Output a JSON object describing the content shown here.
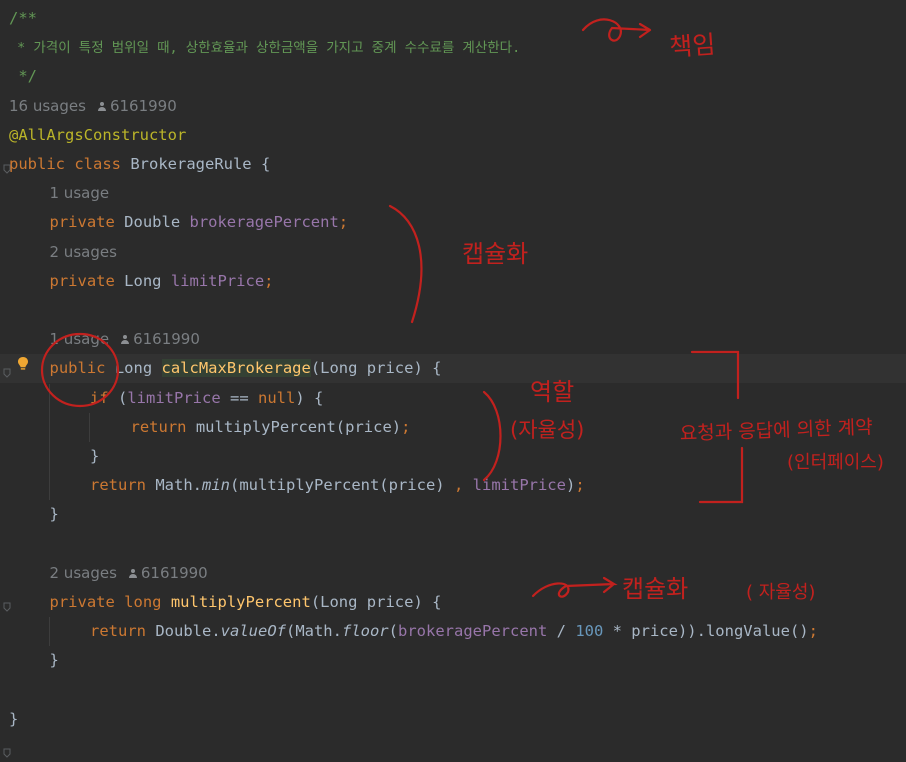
{
  "editor": {
    "lines": [
      {
        "indent": 0,
        "type": "comment",
        "text": "/**"
      },
      {
        "indent": 0,
        "type": "comment",
        "text": " * 가격이 특정 범위일 때, 상한효율과 상한금액을 가지고 중계 수수료를 계산한다."
      },
      {
        "indent": 0,
        "type": "comment",
        "text": " */"
      },
      {
        "indent": 0,
        "type": "hint",
        "usage": "16 usages",
        "author": "6161990"
      },
      {
        "indent": 0,
        "type": "code",
        "tokens": [
          {
            "t": "@AllArgsConstructor",
            "c": "anno"
          }
        ]
      },
      {
        "indent": 0,
        "type": "code",
        "tokens": [
          {
            "t": "public class ",
            "c": "kw"
          },
          {
            "t": "BrokerageRule {"
          }
        ]
      },
      {
        "indent": 1,
        "type": "hint",
        "usage": "1 usage"
      },
      {
        "indent": 1,
        "type": "code",
        "tokens": [
          {
            "t": "private ",
            "c": "kw"
          },
          {
            "t": "Double "
          },
          {
            "t": "brokeragePercent",
            "c": "field"
          },
          {
            "t": ";",
            "c": "kw"
          }
        ]
      },
      {
        "indent": 1,
        "type": "hint",
        "usage": "2 usages"
      },
      {
        "indent": 1,
        "type": "code",
        "tokens": [
          {
            "t": "private ",
            "c": "kw"
          },
          {
            "t": "Long "
          },
          {
            "t": "limitPrice",
            "c": "field"
          },
          {
            "t": ";",
            "c": "kw"
          }
        ]
      },
      {
        "indent": 0,
        "type": "blank"
      },
      {
        "indent": 1,
        "type": "hint",
        "usage": "1 usage",
        "author": "6161990"
      },
      {
        "indent": 1,
        "type": "code",
        "current": true,
        "tokens": [
          {
            "t": "public ",
            "c": "kw"
          },
          {
            "t": "Long "
          },
          {
            "t": "calcMaxBrokerage",
            "c": "mdecl hl"
          },
          {
            "t": "(Long price) {"
          }
        ]
      },
      {
        "indent": 2,
        "type": "code",
        "tokens": [
          {
            "t": "if ",
            "c": "kw"
          },
          {
            "t": "("
          },
          {
            "t": "limitPrice",
            "c": "field"
          },
          {
            "t": " == "
          },
          {
            "t": "null",
            "c": "kw"
          },
          {
            "t": ") {"
          }
        ]
      },
      {
        "indent": 3,
        "type": "code",
        "tokens": [
          {
            "t": "return ",
            "c": "kw"
          },
          {
            "t": "multiplyPercent(price)"
          },
          {
            "t": ";",
            "c": "kw"
          }
        ]
      },
      {
        "indent": 2,
        "type": "code",
        "tokens": [
          {
            "t": "}"
          }
        ]
      },
      {
        "indent": 2,
        "type": "code",
        "tokens": [
          {
            "t": "return ",
            "c": "kw"
          },
          {
            "t": "Math."
          },
          {
            "t": "min",
            "c": "ital"
          },
          {
            "t": "(multiplyPercent(price) "
          },
          {
            "t": ",",
            "c": "kw"
          },
          {
            "t": " "
          },
          {
            "t": "limitPrice",
            "c": "field"
          },
          {
            "t": ")"
          },
          {
            "t": ";",
            "c": "kw"
          }
        ]
      },
      {
        "indent": 1,
        "type": "code",
        "tokens": [
          {
            "t": "}"
          }
        ]
      },
      {
        "indent": 0,
        "type": "blank"
      },
      {
        "indent": 1,
        "type": "hint",
        "usage": "2 usages",
        "author": "6161990"
      },
      {
        "indent": 1,
        "type": "code",
        "tokens": [
          {
            "t": "private long ",
            "c": "kw"
          },
          {
            "t": "multiplyPercent",
            "c": "mdecl"
          },
          {
            "t": "(Long price) {"
          }
        ]
      },
      {
        "indent": 2,
        "type": "code",
        "tokens": [
          {
            "t": "return ",
            "c": "kw"
          },
          {
            "t": "Double."
          },
          {
            "t": "valueOf",
            "c": "ital"
          },
          {
            "t": "(Math."
          },
          {
            "t": "floor",
            "c": "ital"
          },
          {
            "t": "("
          },
          {
            "t": "brokeragePercent",
            "c": "field"
          },
          {
            "t": " / "
          },
          {
            "t": "100",
            "c": "num"
          },
          {
            "t": " * price)).longValue()"
          },
          {
            "t": ";",
            "c": "kw"
          }
        ]
      },
      {
        "indent": 1,
        "type": "code",
        "tokens": [
          {
            "t": "}"
          }
        ]
      },
      {
        "indent": 0,
        "type": "blank"
      },
      {
        "indent": 0,
        "type": "code",
        "tokens": [
          {
            "t": "}"
          }
        ]
      }
    ]
  },
  "annotations": {
    "responsibility": "책임",
    "encapsulation_1": "캡슐화",
    "role": "역할",
    "autonomy": "(자율성)",
    "contract_1": "요청과 응답에 의한 계약",
    "contract_2": "(인터페이스)",
    "encapsulation_2": "캡슐화",
    "autonomy_2": "( 자율성)"
  },
  "colors": {
    "background": "#2b2b2b",
    "annotation_ink": "#c2211e",
    "bulb": "#f0a732"
  }
}
